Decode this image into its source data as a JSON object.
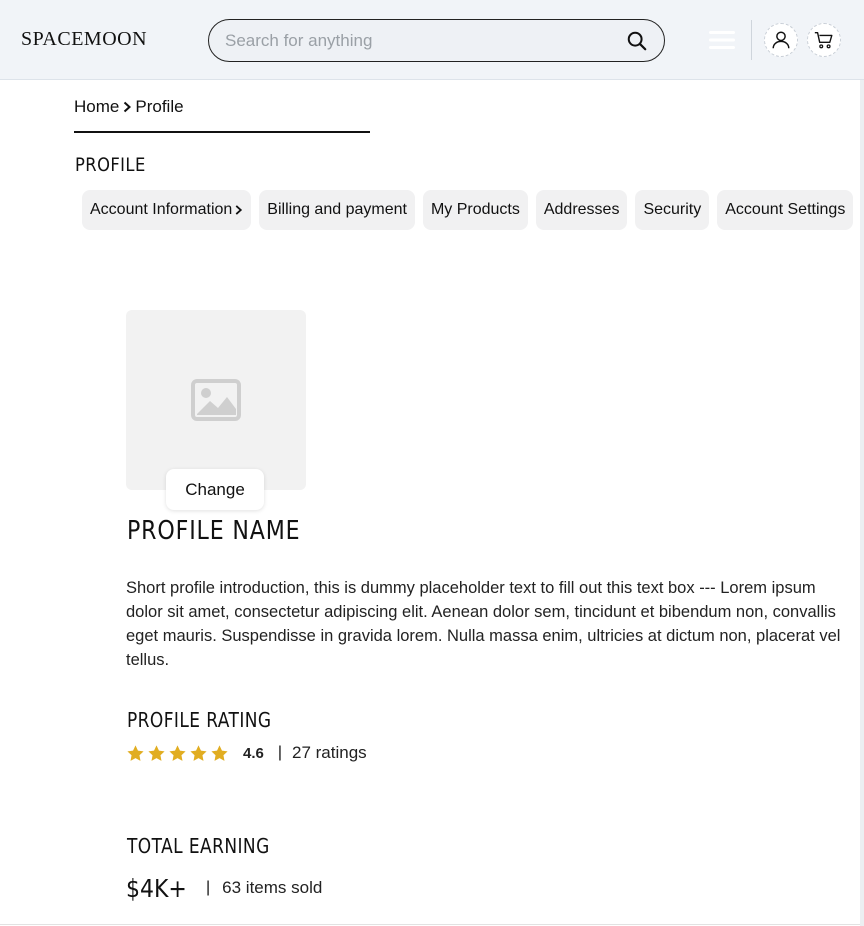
{
  "header": {
    "logo": "SPACEMOON",
    "search": {
      "placeholder": "Search for anything",
      "value": ""
    },
    "icons": {
      "search": "search-icon",
      "menu": "menu-icon",
      "user": "user-icon",
      "cart": "cart-icon"
    }
  },
  "breadcrumb": {
    "home": "Home",
    "current": "Profile"
  },
  "page_title": "PROFILE",
  "tabs": [
    {
      "label": "Account Information"
    },
    {
      "label": "Billing and payment"
    },
    {
      "label": "My Products"
    },
    {
      "label": "Addresses"
    },
    {
      "label": "Security"
    },
    {
      "label": "Account Settings"
    }
  ],
  "profile": {
    "change_label": "Change",
    "name": "PROFILE NAME",
    "intro": "Short profile introduction, this is dummy placeholder text to fill out this text box --- Lorem ipsum dolor sit amet, consectetur adipiscing elit. Aenean dolor sem, tincidunt et bibendum non, convallis eget mauris. Suspendisse in gravida lorem. Nulla massa enim, ultricies at dictum non, placerat vel tellus.",
    "rating_title": "PROFILE RATING",
    "stars_filled": 5,
    "stars_total": 5,
    "rating_value": "4.6",
    "rating_separator": "|",
    "rating_count": "27 ratings",
    "earning_title": "TOTAL EARNING",
    "earning_value": "$4K+",
    "earning_separator": "|",
    "items_sold": "63 items sold"
  },
  "colors": {
    "header_bg": "#f1f4f8",
    "star": "#e1ad21",
    "tab_bg": "#f1f1f2",
    "avatar_bg": "#f2f2f2"
  }
}
